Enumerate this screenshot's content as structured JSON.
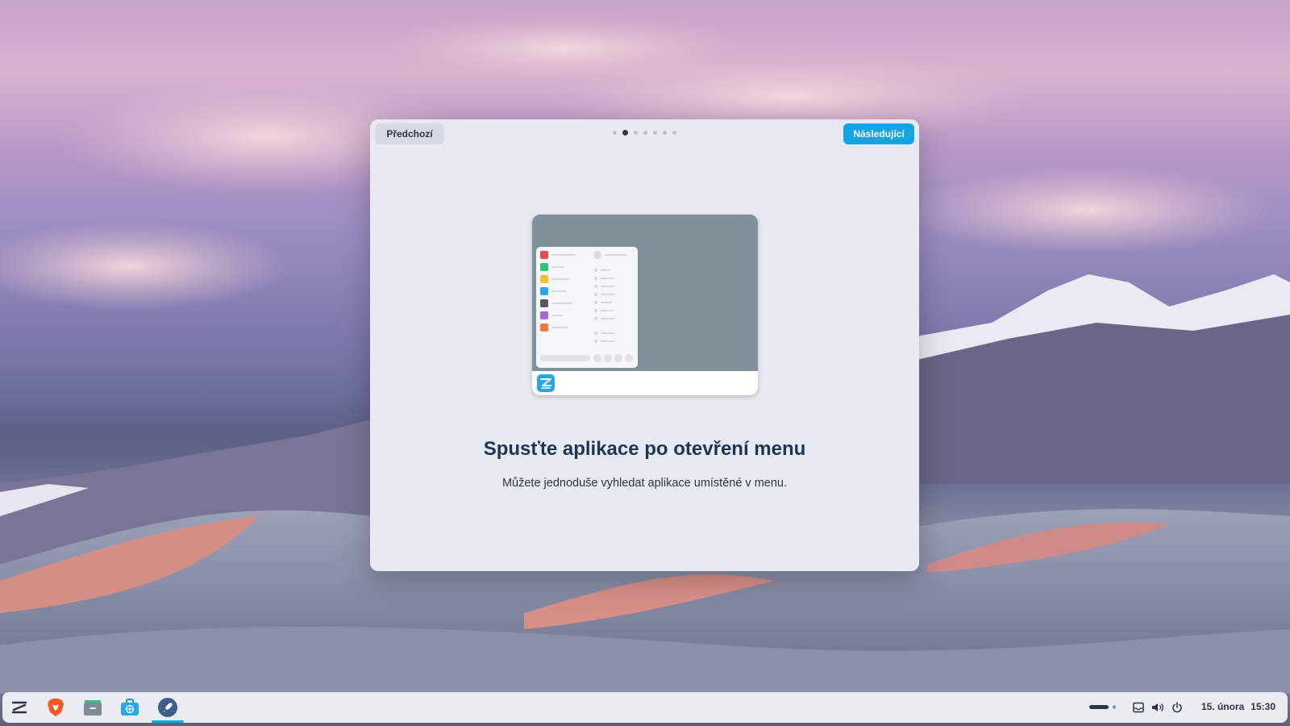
{
  "dialog": {
    "prev_label": "Předchozí",
    "next_label": "Následující",
    "page_count": 7,
    "current_page": 2,
    "title": "Spusťte aplikace po otevření menu",
    "subtitle": "Můžete jednoduše vyhledat aplikace umístěné v menu."
  },
  "taskbar": {
    "apps": [
      "zorin-menu-icon",
      "brave-browser-icon",
      "files-icon",
      "software-store-icon",
      "welcome-rocket-icon"
    ],
    "date": "15. února",
    "time": "15:30"
  },
  "colors": {
    "accent": "#12a4e3",
    "dialog_bg": "#e7eaf0",
    "title_text": "#1f3554"
  }
}
